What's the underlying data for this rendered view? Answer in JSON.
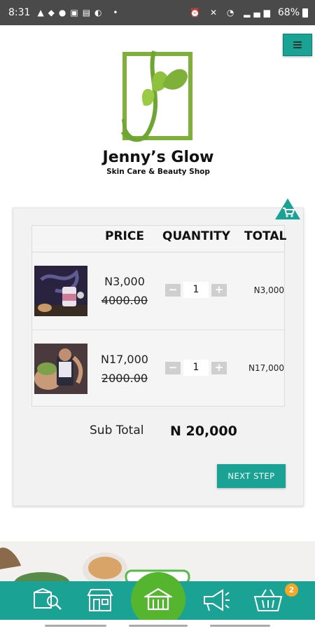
{
  "status_bar": {
    "time": "8:31",
    "battery": "68%"
  },
  "header": {
    "menu_icon": "hamburger-menu-icon"
  },
  "brand": {
    "name": "Jenny’s Glow",
    "subtitle": "Skin Care & Beauty Shop"
  },
  "cart": {
    "headers": {
      "price": "PRICE",
      "quantity": "QUANTITY",
      "total": "TOTAL"
    },
    "items": [
      {
        "image": "candle-product-photo",
        "price": "N3,000",
        "old_price": "4000.00",
        "quantity": "1",
        "total": "N3,000"
      },
      {
        "image": "jar-product-photo",
        "price": "N17,000",
        "old_price": "2000.00",
        "quantity": "1",
        "total": "N17,000"
      }
    ],
    "minus": "−",
    "plus": "+",
    "subtotal_label": "Sub Total",
    "subtotal_value": "N 20,000",
    "next_button": "NEXT STEP"
  },
  "bottom_nav": {
    "items": [
      "catalog-icon",
      "store-icon",
      "home-icon",
      "megaphone-icon",
      "basket-icon"
    ],
    "cart_count": "2"
  },
  "colors": {
    "teal": "#1aa394",
    "green": "#55b52f",
    "badge": "#f5a623"
  }
}
